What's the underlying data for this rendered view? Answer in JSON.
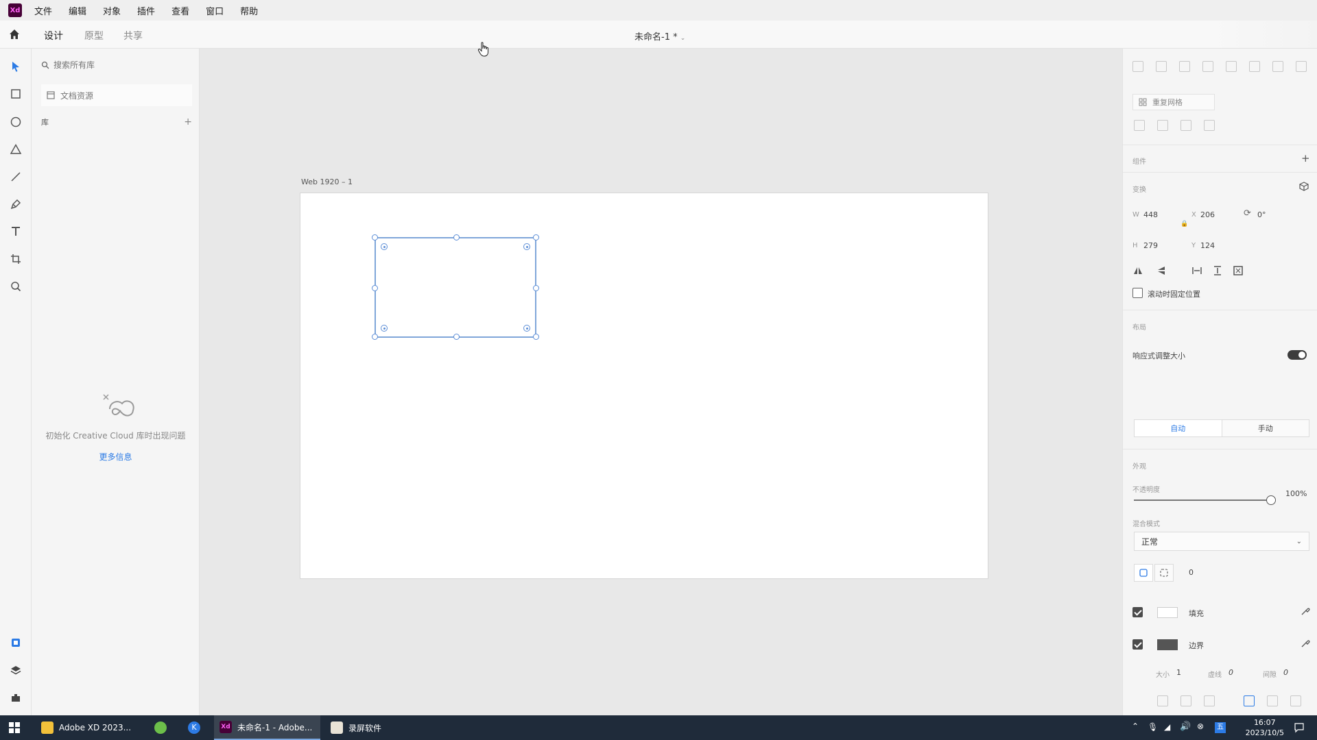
{
  "menu": [
    "文件",
    "编辑",
    "对象",
    "插件",
    "查看",
    "窗口",
    "帮助"
  ],
  "app": {
    "logo": "Xd",
    "document_title": "未命名-1 *"
  },
  "tabs": [
    {
      "label": "设计"
    },
    {
      "label": "原型"
    },
    {
      "label": "共享"
    }
  ],
  "library": {
    "search_placeholder": "搜索所有库",
    "doc_assets": "文档资源",
    "section": "库",
    "cc_message": "初始化 Creative Cloud 库时出现问题",
    "more_info": "更多信息"
  },
  "canvas": {
    "artboard_name": "Web 1920 – 1"
  },
  "props": {
    "repeat_grid": "重复网格",
    "components": "组件",
    "transform": "变换",
    "w_label": "W",
    "w": "448",
    "h_label": "H",
    "h": "279",
    "x_label": "X",
    "x": "206",
    "y_label": "Y",
    "y": "124",
    "rotation": "0°",
    "fix_scroll": "滚动时固定位置",
    "layout": "布局",
    "responsive": "响应式调整大小",
    "auto": "自动",
    "manual": "手动",
    "appearance": "外观",
    "opacity_label": "不透明度",
    "opacity": "100%",
    "opacity_value": 1.0,
    "blend_label": "混合模式",
    "blend": "正常",
    "corner": "0",
    "fill_label": "填充",
    "border_label": "边界",
    "size_label": "大小",
    "size": "1",
    "dash_label": "虚线",
    "dash": "0",
    "gap_label": "间隙",
    "gap": "0"
  },
  "taskbar": {
    "items": [
      "Adobe XD 2023...",
      "未命名-1 - Adobe...",
      "录屏软件"
    ],
    "time": "16:07",
    "date": "2023/10/5",
    "ime": "五"
  },
  "colors": {
    "accent": "#2c7be5",
    "selection": "#7fa6d9",
    "border_swatch": "#555555",
    "fill_swatch": "#ffffff"
  }
}
